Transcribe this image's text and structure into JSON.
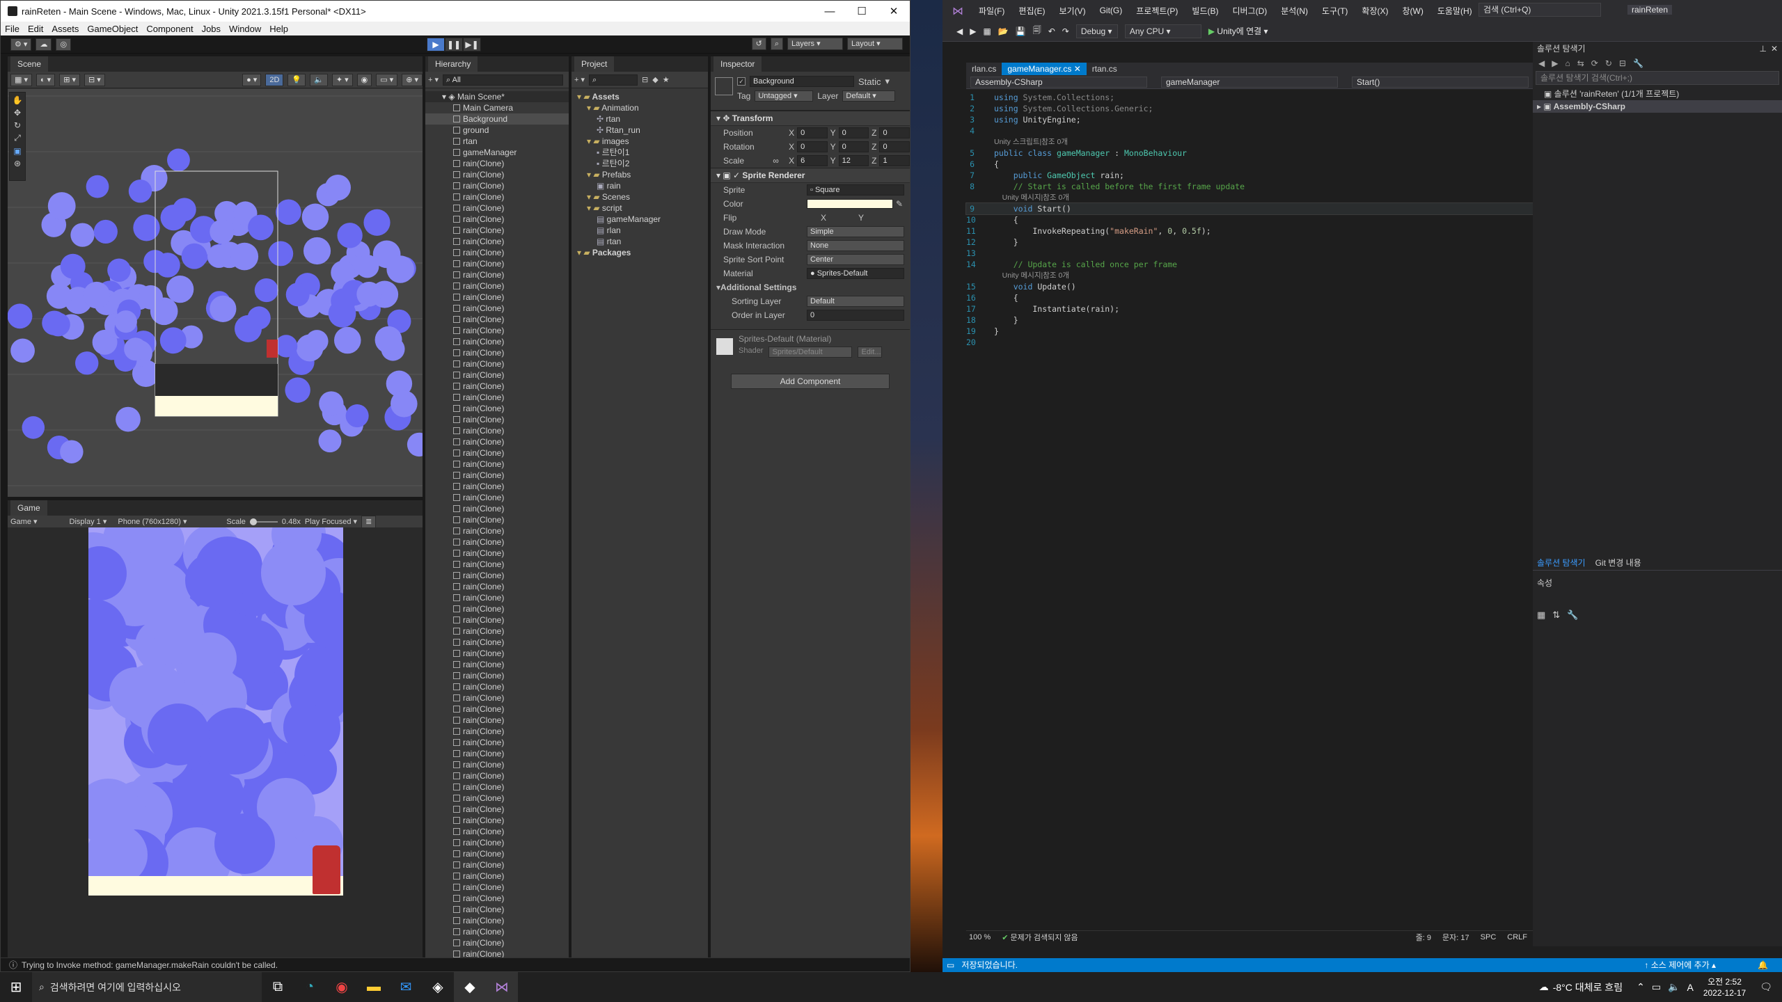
{
  "unity": {
    "title": "rainReten - Main Scene - Windows, Mac, Linux - Unity 2021.3.15f1 Personal* <DX11>",
    "menu": [
      "File",
      "Edit",
      "Assets",
      "GameObject",
      "Component",
      "Jobs",
      "Window",
      "Help"
    ],
    "layers_label": "Layers",
    "layout_label": "Layout",
    "scene_tab": "Scene",
    "scene_2d": "2D",
    "game_tab": "Game",
    "game_toolbar": {
      "view": "Game",
      "display": "Display 1",
      "resolution": "Phone (760x1280)",
      "scale_label": "Scale",
      "scale_value": "0.48x",
      "play_focused": "Play Focused"
    },
    "hierarchy": {
      "tab": "Hierarchy",
      "search_placeholder": "All",
      "scene_name": "Main Scene*",
      "items": [
        "Main Camera",
        "Background",
        "ground",
        "rtan",
        "gameManager"
      ],
      "clone_name": "rain(Clone)",
      "clone_count": 78
    },
    "project": {
      "tab": "Project",
      "tree": [
        {
          "label": "Assets",
          "depth": 0,
          "bold": true,
          "icon": "folder"
        },
        {
          "label": "Animation",
          "depth": 1,
          "icon": "folder"
        },
        {
          "label": "rtan",
          "depth": 2,
          "icon": "anim"
        },
        {
          "label": "Rtan_run",
          "depth": 2,
          "icon": "anim"
        },
        {
          "label": "images",
          "depth": 1,
          "icon": "folder"
        },
        {
          "label": "르탄이1",
          "depth": 2,
          "icon": "sprite"
        },
        {
          "label": "르탄이2",
          "depth": 2,
          "icon": "sprite"
        },
        {
          "label": "Prefabs",
          "depth": 1,
          "icon": "folder"
        },
        {
          "label": "rain",
          "depth": 2,
          "icon": "prefab"
        },
        {
          "label": "Scenes",
          "depth": 1,
          "icon": "folder"
        },
        {
          "label": "script",
          "depth": 1,
          "icon": "folder"
        },
        {
          "label": "gameManager",
          "depth": 2,
          "icon": "script"
        },
        {
          "label": "rlan",
          "depth": 2,
          "icon": "script"
        },
        {
          "label": "rtan",
          "depth": 2,
          "icon": "script"
        },
        {
          "label": "Packages",
          "depth": 0,
          "bold": true,
          "icon": "folder"
        }
      ]
    },
    "inspector": {
      "tab": "Inspector",
      "object_name": "Background",
      "static_label": "Static",
      "tag_label": "Tag",
      "tag_value": "Untagged",
      "layer_label": "Layer",
      "layer_value": "Default",
      "transform_title": "Transform",
      "position": {
        "label": "Position",
        "x": "0",
        "y": "0",
        "z": "0"
      },
      "rotation": {
        "label": "Rotation",
        "x": "0",
        "y": "0",
        "z": "0"
      },
      "scale": {
        "label": "Scale",
        "x": "6",
        "y": "12",
        "z": "1"
      },
      "sprite_renderer_title": "Sprite Renderer",
      "sprite": {
        "label": "Sprite",
        "value": "Square"
      },
      "color": {
        "label": "Color",
        "value": "#fffbe0"
      },
      "flip": {
        "label": "Flip",
        "x": "X",
        "y": "Y"
      },
      "draw_mode": {
        "label": "Draw Mode",
        "value": "Simple"
      },
      "mask_interaction": {
        "label": "Mask Interaction",
        "value": "None"
      },
      "sort_point": {
        "label": "Sprite Sort Point",
        "value": "Center"
      },
      "material": {
        "label": "Material",
        "value": "Sprites-Default"
      },
      "additional_settings": "Additional Settings",
      "sorting_layer": {
        "label": "Sorting Layer",
        "value": "Default"
      },
      "order_in_layer": {
        "label": "Order in Layer",
        "value": "0"
      },
      "material_block": {
        "name": "Sprites-Default (Material)",
        "shader_label": "Shader",
        "shader_value": "Sprites/Default",
        "edit": "Edit..."
      },
      "add_component": "Add Component"
    },
    "status": "Trying to Invoke method: gameManager.makeRain couldn't be called."
  },
  "vs": {
    "menu": [
      "파일(F)",
      "편집(E)",
      "보기(V)",
      "Git(G)",
      "프로젝트(P)",
      "빌드(B)",
      "디버그(D)",
      "분석(N)",
      "도구(T)",
      "확장(X)",
      "창(W)",
      "도움말(H)"
    ],
    "search_placeholder": "검색 (Ctrl+Q)",
    "project_badge": "rainReten",
    "config": "Debug",
    "platform": "Any CPU",
    "run_label": "Unity에 연결",
    "tabs": [
      {
        "label": "rlan.cs",
        "active": false
      },
      {
        "label": "gameManager.cs",
        "active": true
      },
      {
        "label": "rtan.cs",
        "active": false
      }
    ],
    "nav": {
      "project": "Assembly-CSharp",
      "class": "gameManager",
      "member": "Start()"
    },
    "code_lines": [
      {
        "n": "1",
        "ref": "",
        "segs": [
          [
            "using",
            "kw"
          ],
          [
            " System.Collections;",
            "gr"
          ]
        ]
      },
      {
        "n": "2",
        "ref": "",
        "segs": [
          [
            "using",
            "kw"
          ],
          [
            " System.Collections.Generic;",
            "gr"
          ]
        ]
      },
      {
        "n": "3",
        "ref": "",
        "segs": [
          [
            "using",
            "kw"
          ],
          [
            " UnityEngine;",
            ""
          ]
        ]
      },
      {
        "n": "4",
        "ref": "",
        "segs": []
      },
      {
        "n": "",
        "ref": "Unity 스크립트|참조 0개",
        "segs": []
      },
      {
        "n": "5",
        "ref": "",
        "segs": [
          [
            "public class ",
            "kw"
          ],
          [
            "gameManager",
            "ty"
          ],
          [
            " : ",
            ""
          ],
          [
            "MonoBehaviour",
            "ty"
          ]
        ]
      },
      {
        "n": "6",
        "ref": "",
        "segs": [
          [
            "{",
            ""
          ]
        ]
      },
      {
        "n": "7",
        "ref": "",
        "segs": [
          [
            "    public ",
            "kw"
          ],
          [
            "GameObject",
            "ty"
          ],
          [
            " rain;",
            ""
          ]
        ]
      },
      {
        "n": "8",
        "ref": "",
        "segs": [
          [
            "    // Start is called before the first frame update",
            "cm"
          ]
        ]
      },
      {
        "n": "",
        "ref": "    Unity 메시지|참조 0개",
        "segs": []
      },
      {
        "n": "9",
        "ref": "",
        "segs": [
          [
            "    void ",
            "kw"
          ],
          [
            "Start",
            ""
          ],
          [
            "()",
            ""
          ]
        ]
      },
      {
        "n": "10",
        "ref": "",
        "segs": [
          [
            "    {",
            ""
          ]
        ]
      },
      {
        "n": "11",
        "ref": "",
        "segs": [
          [
            "        InvokeRepeating(",
            ""
          ],
          [
            "\"makeRain\"",
            "st"
          ],
          [
            ", ",
            ""
          ],
          [
            "0",
            "nm"
          ],
          [
            ", ",
            ""
          ],
          [
            "0.5f",
            "nm"
          ],
          [
            ");",
            ""
          ]
        ]
      },
      {
        "n": "12",
        "ref": "",
        "segs": [
          [
            "    }",
            ""
          ]
        ]
      },
      {
        "n": "13",
        "ref": "",
        "segs": []
      },
      {
        "n": "14",
        "ref": "",
        "segs": [
          [
            "    // Update is called once per frame",
            "cm"
          ]
        ]
      },
      {
        "n": "",
        "ref": "    Unity 메시지|참조 0개",
        "segs": []
      },
      {
        "n": "15",
        "ref": "",
        "segs": [
          [
            "    void ",
            "kw"
          ],
          [
            "Update",
            ""
          ],
          [
            "()",
            ""
          ]
        ]
      },
      {
        "n": "16",
        "ref": "",
        "segs": [
          [
            "    {",
            ""
          ]
        ]
      },
      {
        "n": "17",
        "ref": "",
        "segs": [
          [
            "        Instantiate(rain);",
            ""
          ]
        ]
      },
      {
        "n": "18",
        "ref": "",
        "segs": [
          [
            "    }",
            ""
          ]
        ]
      },
      {
        "n": "19",
        "ref": "",
        "segs": [
          [
            "}",
            ""
          ]
        ]
      },
      {
        "n": "20",
        "ref": "",
        "segs": []
      }
    ],
    "zoom": "100 %",
    "issues": "문제가 검색되지 않음",
    "cursor_line": "줄: 9",
    "cursor_col": "문자: 17",
    "spc": "SPC",
    "crlf": "CRLF",
    "solution": {
      "title": "솔루션 탐색기",
      "search_placeholder": "솔루션 탐색기 검색(Ctrl+;)",
      "solution_item": "솔루션 'rainReten' (1/1개 프로젝트)",
      "project_item": "Assembly-CSharp",
      "bottom_tabs": [
        "솔루션 탐색기",
        "Git 변경 내용"
      ],
      "properties_title": "속성"
    },
    "status_saved": "저장되었습니다.",
    "source_control": "소스 제어에 추가"
  },
  "taskbar": {
    "search_placeholder": "검색하려면 여기에 입력하십시오",
    "weather": "-8°C  대체로 흐림",
    "time": "오전 2:52",
    "date": "2022-12-17",
    "ime": "A"
  }
}
